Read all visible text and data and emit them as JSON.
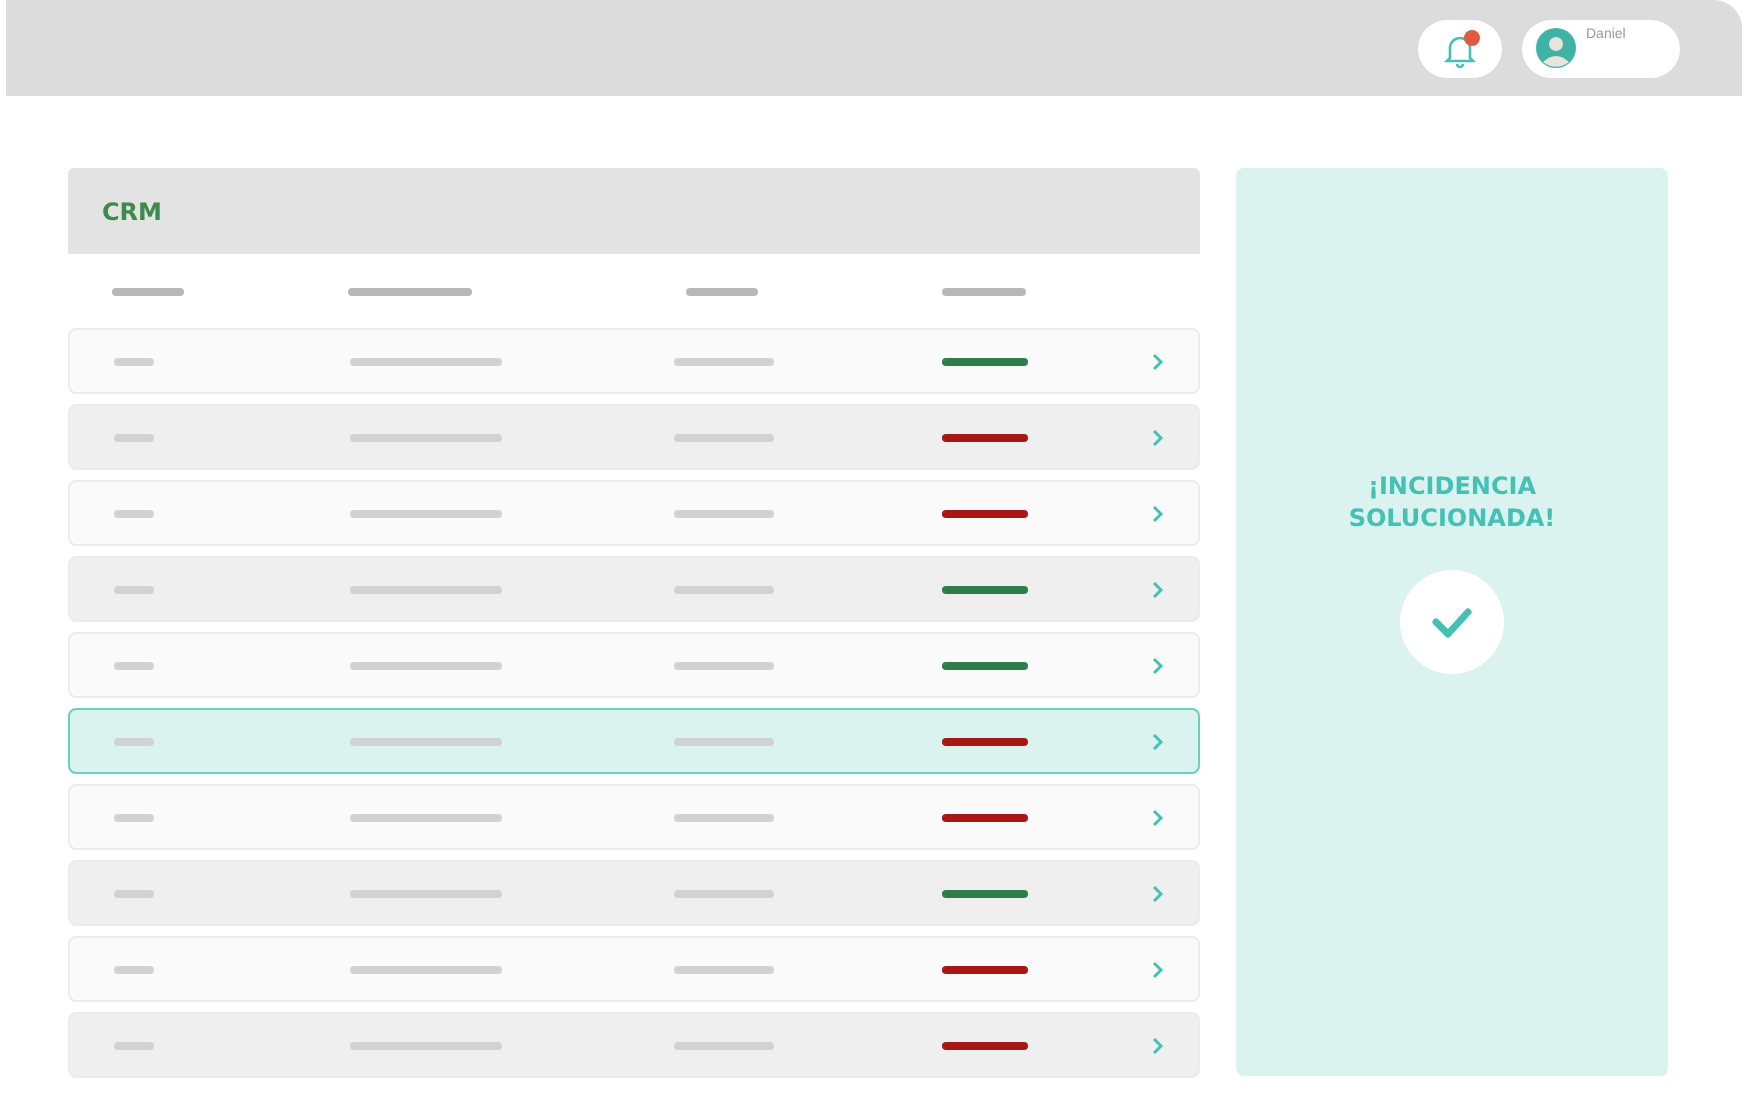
{
  "user": {
    "name": "Daniel"
  },
  "notifications": {
    "unread": true
  },
  "table": {
    "title": "CRM",
    "rows": [
      {
        "color": "#2e7d4a",
        "selected": false
      },
      {
        "color": "#a81616",
        "selected": false
      },
      {
        "color": "#a81616",
        "selected": false
      },
      {
        "color": "#2e7d4a",
        "selected": false
      },
      {
        "color": "#2e7d4a",
        "selected": false
      },
      {
        "color": "#a81616",
        "selected": true
      },
      {
        "color": "#a81616",
        "selected": false
      },
      {
        "color": "#2e7d4a",
        "selected": false
      },
      {
        "color": "#a81616",
        "selected": false
      },
      {
        "color": "#a81616",
        "selected": false
      }
    ]
  },
  "panel": {
    "message": "¡INCIDENCIA SOLUCIONADA!"
  }
}
